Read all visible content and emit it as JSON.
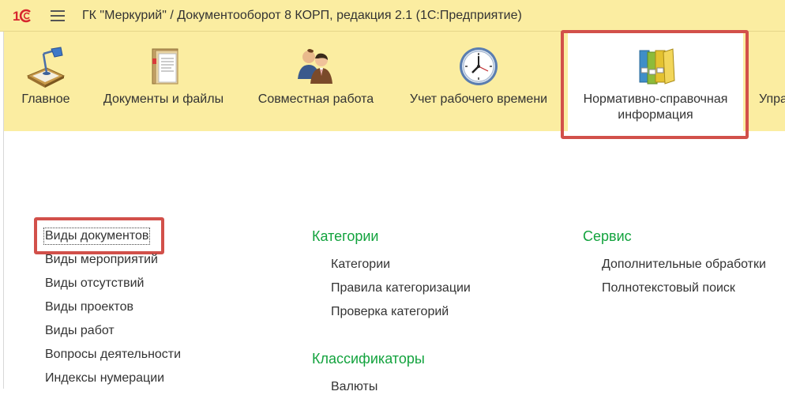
{
  "window": {
    "title": "ГК \"Меркурий\" / Документооборот 8 КОРП, редакция 2.1  (1С:Предприятие)"
  },
  "toolbar": {
    "sections": [
      {
        "label": "Главное",
        "icon": "desk-lamp-icon"
      },
      {
        "label": "Документы и файлы",
        "icon": "document-folder-icon"
      },
      {
        "label": "Совместная работа",
        "icon": "people-icon"
      },
      {
        "label": "Учет рабочего времени",
        "icon": "clock-icon"
      },
      {
        "label_line1": "Нормативно-справочная",
        "label_line2": "информация",
        "icon": "binders-icon",
        "active": true
      },
      {
        "label": "Упра",
        "icon": ""
      }
    ]
  },
  "content": {
    "column1": {
      "items": [
        "Виды документов",
        "Виды мероприятий",
        "Виды отсутствий",
        "Виды проектов",
        "Виды работ",
        "Вопросы деятельности",
        "Индексы нумерации"
      ]
    },
    "column2": {
      "group1_title": "Категории",
      "group1_items": [
        "Категории",
        "Правила категоризации",
        "Проверка категорий"
      ],
      "group2_title": "Классификаторы",
      "group2_items": [
        "Валюты"
      ]
    },
    "column3": {
      "group1_title": "Сервис",
      "group1_items": [
        "Дополнительные обработки",
        "Полнотекстовый поиск"
      ]
    }
  },
  "colors": {
    "panel_bg": "#fbeda1",
    "highlight": "#d2504a",
    "group_title": "#13a33e"
  }
}
